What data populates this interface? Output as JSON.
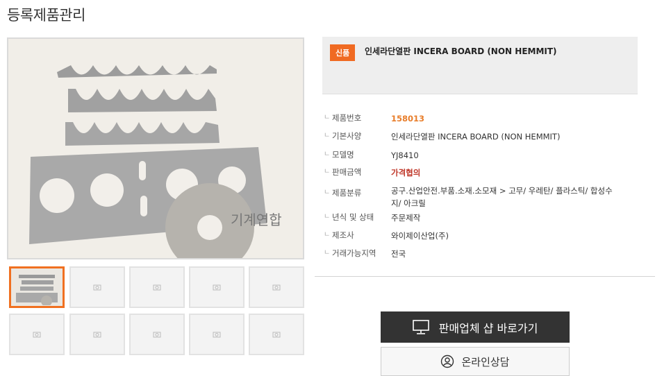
{
  "page": {
    "title": "등록제품관리"
  },
  "product": {
    "badge": "신품",
    "title": "인세라단열판 INCERA BOARD (NON HEMMIT)",
    "watermark": "기계연합",
    "details": [
      {
        "label": "제품번호",
        "value": "158013",
        "style": "orange"
      },
      {
        "label": "기본사양",
        "value": "인세라단열판 INCERA BOARD (NON HEMMIT)",
        "style": ""
      },
      {
        "label": "모델명",
        "value": "YJ8410",
        "style": ""
      },
      {
        "label": "판매금액",
        "value": "가격협의",
        "style": "red"
      },
      {
        "label": "제품분류",
        "value": "공구.산업안전.부품.소재.소모재 > 고무/ 우레탄/ 플라스틱/ 합성수지/ 아크릴",
        "style": ""
      },
      {
        "label": "년식 및 상태",
        "value": "주문제작",
        "style": ""
      },
      {
        "label": "제조사",
        "value": "와이제이산업(주)",
        "style": ""
      },
      {
        "label": "거래가능지역",
        "value": "전국",
        "style": ""
      }
    ]
  },
  "thumbnails": {
    "count": 10,
    "active_index": 0
  },
  "buttons": {
    "shop": "판매업체 샵 바로가기",
    "consult": "온라인상담"
  },
  "colors": {
    "accent": "#f06a22",
    "dark_button": "#333333",
    "price": "#c0392b"
  }
}
